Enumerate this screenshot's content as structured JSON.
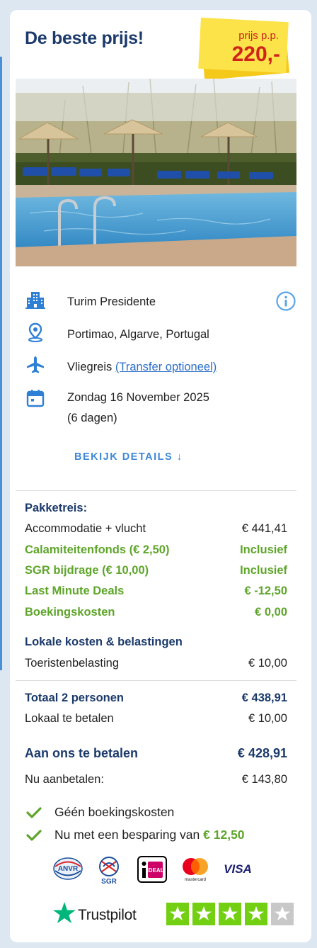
{
  "card": {
    "title": "De beste prijs!",
    "price_label": "prijs p.p.",
    "price_value": "220,-"
  },
  "hotel": {
    "name": "Turim Presidente",
    "location": "Portimao, Algarve, Portugal",
    "travel_type": "Vliegreis",
    "transfer_link": "(Transfer optioneel)",
    "date": "Zondag 16 November 2025",
    "duration": "(6 dagen)",
    "details_label": "BEKIJK DETAILS ↓"
  },
  "pricing": {
    "package_heading": "Pakketreis:",
    "lines": [
      {
        "label": "Accommodatie + vlucht",
        "value": "€ 441,41",
        "style": "normal"
      },
      {
        "label": "Calamiteitenfonds (€ 2,50)",
        "value": "Inclusief",
        "style": "green"
      },
      {
        "label": "SGR bijdrage (€ 10,00)",
        "value": "Inclusief",
        "style": "green"
      },
      {
        "label": "Last Minute Deals",
        "value": "€ -12,50",
        "style": "green"
      },
      {
        "label": "Boekingskosten",
        "value": "€ 0,00",
        "style": "green"
      }
    ],
    "local_heading": "Lokale kosten & belastingen",
    "tourist_tax_label": "Toeristenbelasting",
    "tourist_tax_value": "€ 10,00",
    "total_label": "Totaal 2 personen",
    "total_value": "€ 438,91",
    "local_pay_label": "Lokaal te betalen",
    "local_pay_value": "€ 10,00",
    "pay_us_label": "Aan ons te betalen",
    "pay_us_value": "€ 428,91",
    "deposit_label": "Nu aanbetalen:",
    "deposit_value": "€ 143,80"
  },
  "benefits": {
    "no_fees": "Géén boekingskosten",
    "savings_prefix": "Nu met een besparing van",
    "savings_amount": "€ 12,50"
  },
  "payment_logos": {
    "anvr": "ANVR",
    "sgr": "SGR",
    "ideal": "iDEAL",
    "mastercard": "mastercard",
    "visa": "VISA"
  },
  "trustpilot": {
    "label": "Trustpilot",
    "rating_stars": 4,
    "max_stars": 5
  },
  "colors": {
    "brand_blue": "#1b3a6b",
    "link_blue": "#3f87d8",
    "accent_green": "#5ea52a",
    "price_red": "#d0241a",
    "sticker_yellow": "#fde34a",
    "trustpilot_green": "#73cf11"
  }
}
